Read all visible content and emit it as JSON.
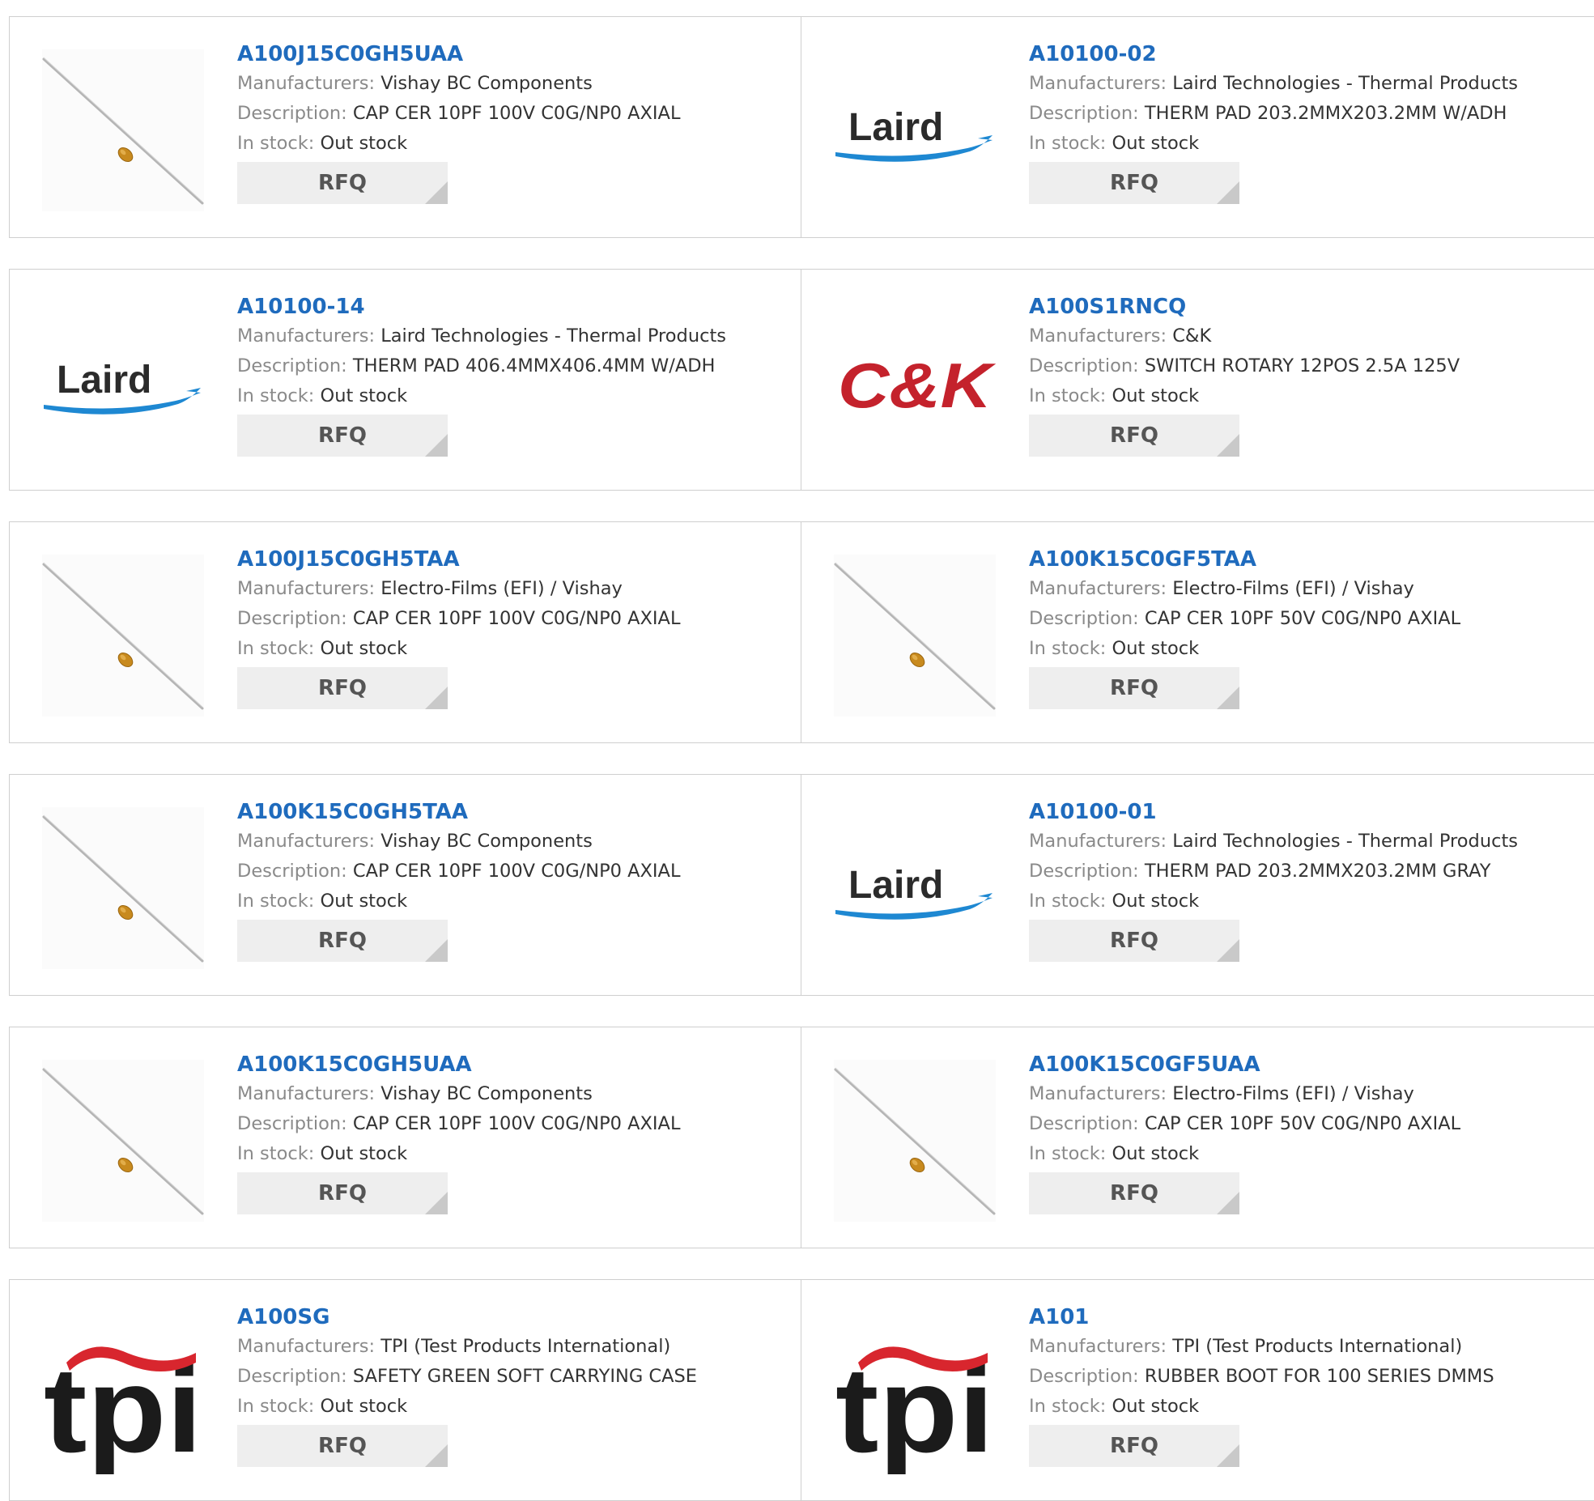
{
  "labels": {
    "manufacturers": "Manufacturers:",
    "description": "Description:",
    "in_stock": "In stock:",
    "rfq": "RFQ"
  },
  "colors": {
    "part_link": "#1f6bbd",
    "label_gray": "#8a8a8a",
    "value_text": "#333333",
    "rfq_bg": "#eeeeee",
    "border": "#cfcfcf",
    "laird_blue": "#1e88d2",
    "ck_red": "#c4222c",
    "tpi_red": "#d8262e"
  },
  "products": [
    {
      "part": "A100J15C0GH5UAA",
      "manufacturer": "Vishay BC Components",
      "description": "CAP CER 10PF 100V C0G/NP0 AXIAL",
      "stock": "Out stock",
      "image": "capacitor"
    },
    {
      "part": "A10100-02",
      "manufacturer": "Laird Technologies - Thermal Products",
      "description": "THERM PAD 203.2MMX203.2MM W/ADH",
      "stock": "Out stock",
      "image": "laird-logo",
      "logo_text": "Laird"
    },
    {
      "part": "A10100-14",
      "manufacturer": "Laird Technologies - Thermal Products",
      "description": "THERM PAD 406.4MMX406.4MM W/ADH",
      "stock": "Out stock",
      "image": "laird-logo",
      "logo_text": "Laird"
    },
    {
      "part": "A100S1RNCQ",
      "manufacturer": "C&K",
      "description": "SWITCH ROTARY 12POS 2.5A 125V",
      "stock": "Out stock",
      "image": "ck-logo",
      "logo_text": "C&K"
    },
    {
      "part": "A100J15C0GH5TAA",
      "manufacturer": "Electro-Films (EFI) / Vishay",
      "description": "CAP CER 10PF 100V C0G/NP0 AXIAL",
      "stock": "Out stock",
      "image": "capacitor"
    },
    {
      "part": "A100K15C0GF5TAA",
      "manufacturer": "Electro-Films (EFI) / Vishay",
      "description": "CAP CER 10PF 50V C0G/NP0 AXIAL",
      "stock": "Out stock",
      "image": "capacitor"
    },
    {
      "part": "A100K15C0GH5TAA",
      "manufacturer": "Vishay BC Components",
      "description": "CAP CER 10PF 100V C0G/NP0 AXIAL",
      "stock": "Out stock",
      "image": "capacitor"
    },
    {
      "part": "A10100-01",
      "manufacturer": "Laird Technologies - Thermal Products",
      "description": "THERM PAD 203.2MMX203.2MM GRAY",
      "stock": "Out stock",
      "image": "laird-logo",
      "logo_text": "Laird"
    },
    {
      "part": "A100K15C0GH5UAA",
      "manufacturer": "Vishay BC Components",
      "description": "CAP CER 10PF 100V C0G/NP0 AXIAL",
      "stock": "Out stock",
      "image": "capacitor"
    },
    {
      "part": "A100K15C0GF5UAA",
      "manufacturer": "Electro-Films (EFI) / Vishay",
      "description": "CAP CER 10PF 50V C0G/NP0 AXIAL",
      "stock": "Out stock",
      "image": "capacitor"
    },
    {
      "part": "A100SG",
      "manufacturer": "TPI (Test Products International)",
      "description": "SAFETY GREEN SOFT CARRYING CASE",
      "stock": "Out stock",
      "image": "tpi-logo",
      "logo_text": "tpi"
    },
    {
      "part": "A101",
      "manufacturer": "TPI (Test Products International)",
      "description": "RUBBER BOOT FOR 100 SERIES DMMS",
      "stock": "Out stock",
      "image": "tpi-logo",
      "logo_text": "tpi"
    }
  ]
}
